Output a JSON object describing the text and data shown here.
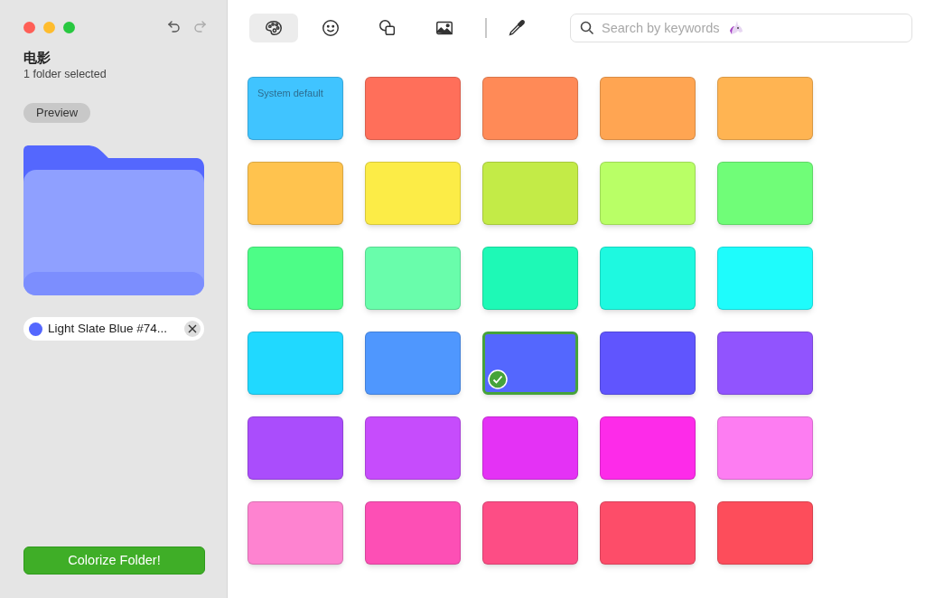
{
  "sidebar": {
    "folder_name": "电影",
    "subtitle": "1 folder selected",
    "preview_label": "Preview",
    "color_chip": {
      "label": "Light Slate Blue #74...",
      "color": "#5467fe"
    },
    "action_button": "Colorize Folder!"
  },
  "toolbar": {
    "tabs": [
      {
        "kind": "palette",
        "selected": true
      },
      {
        "kind": "emoji",
        "selected": false
      },
      {
        "kind": "shapes",
        "selected": false
      },
      {
        "kind": "image",
        "selected": false
      }
    ],
    "search": {
      "placeholder": "Search by keywords"
    }
  },
  "swatches": [
    {
      "color": "#40c4ff",
      "label": "System default",
      "selected": false
    },
    {
      "color": "#ff6f5a",
      "selected": false
    },
    {
      "color": "#ff8a57",
      "selected": false
    },
    {
      "color": "#ffa552",
      "selected": false
    },
    {
      "color": "#ffb452",
      "selected": false
    },
    {
      "color": "#ffc34e",
      "selected": false
    },
    {
      "color": "#fcec47",
      "selected": false
    },
    {
      "color": "#c3eb47",
      "selected": false
    },
    {
      "color": "#b9ff66",
      "selected": false
    },
    {
      "color": "#70fd78",
      "selected": false
    },
    {
      "color": "#4dfd87",
      "selected": false
    },
    {
      "color": "#69fdab",
      "selected": false
    },
    {
      "color": "#1ef9b6",
      "selected": false
    },
    {
      "color": "#1ef9e0",
      "selected": false
    },
    {
      "color": "#1efcfc",
      "selected": false
    },
    {
      "color": "#20d9ff",
      "selected": false
    },
    {
      "color": "#4f97fe",
      "selected": false
    },
    {
      "color": "#5467fe",
      "selected": true
    },
    {
      "color": "#6055fe",
      "selected": false
    },
    {
      "color": "#9154fe",
      "selected": false
    },
    {
      "color": "#aa4dfc",
      "selected": false
    },
    {
      "color": "#c64cfc",
      "selected": false
    },
    {
      "color": "#e432f5",
      "selected": false
    },
    {
      "color": "#fd2be9",
      "selected": false
    },
    {
      "color": "#fd7df2",
      "selected": false
    },
    {
      "color": "#fe83d0",
      "selected": false
    },
    {
      "color": "#fd4fb5",
      "selected": false
    },
    {
      "color": "#fd4d85",
      "selected": false
    },
    {
      "color": "#fd4d69",
      "selected": false
    },
    {
      "color": "#fd4d5b",
      "selected": false
    }
  ]
}
